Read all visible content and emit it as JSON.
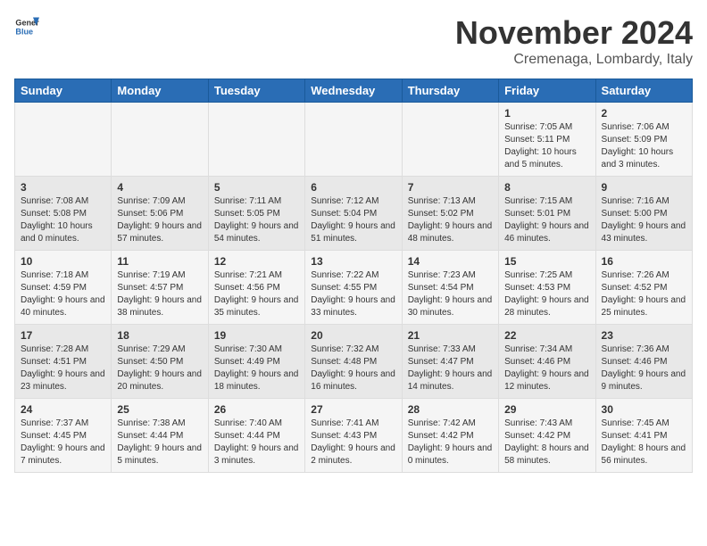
{
  "logo": {
    "general": "General",
    "blue": "Blue"
  },
  "title": "November 2024",
  "subtitle": "Cremenaga, Lombardy, Italy",
  "days_header": [
    "Sunday",
    "Monday",
    "Tuesday",
    "Wednesday",
    "Thursday",
    "Friday",
    "Saturday"
  ],
  "weeks": [
    [
      {
        "day": "",
        "info": ""
      },
      {
        "day": "",
        "info": ""
      },
      {
        "day": "",
        "info": ""
      },
      {
        "day": "",
        "info": ""
      },
      {
        "day": "",
        "info": ""
      },
      {
        "day": "1",
        "info": "Sunrise: 7:05 AM\nSunset: 5:11 PM\nDaylight: 10 hours and 5 minutes."
      },
      {
        "day": "2",
        "info": "Sunrise: 7:06 AM\nSunset: 5:09 PM\nDaylight: 10 hours and 3 minutes."
      }
    ],
    [
      {
        "day": "3",
        "info": "Sunrise: 7:08 AM\nSunset: 5:08 PM\nDaylight: 10 hours and 0 minutes."
      },
      {
        "day": "4",
        "info": "Sunrise: 7:09 AM\nSunset: 5:06 PM\nDaylight: 9 hours and 57 minutes."
      },
      {
        "day": "5",
        "info": "Sunrise: 7:11 AM\nSunset: 5:05 PM\nDaylight: 9 hours and 54 minutes."
      },
      {
        "day": "6",
        "info": "Sunrise: 7:12 AM\nSunset: 5:04 PM\nDaylight: 9 hours and 51 minutes."
      },
      {
        "day": "7",
        "info": "Sunrise: 7:13 AM\nSunset: 5:02 PM\nDaylight: 9 hours and 48 minutes."
      },
      {
        "day": "8",
        "info": "Sunrise: 7:15 AM\nSunset: 5:01 PM\nDaylight: 9 hours and 46 minutes."
      },
      {
        "day": "9",
        "info": "Sunrise: 7:16 AM\nSunset: 5:00 PM\nDaylight: 9 hours and 43 minutes."
      }
    ],
    [
      {
        "day": "10",
        "info": "Sunrise: 7:18 AM\nSunset: 4:59 PM\nDaylight: 9 hours and 40 minutes."
      },
      {
        "day": "11",
        "info": "Sunrise: 7:19 AM\nSunset: 4:57 PM\nDaylight: 9 hours and 38 minutes."
      },
      {
        "day": "12",
        "info": "Sunrise: 7:21 AM\nSunset: 4:56 PM\nDaylight: 9 hours and 35 minutes."
      },
      {
        "day": "13",
        "info": "Sunrise: 7:22 AM\nSunset: 4:55 PM\nDaylight: 9 hours and 33 minutes."
      },
      {
        "day": "14",
        "info": "Sunrise: 7:23 AM\nSunset: 4:54 PM\nDaylight: 9 hours and 30 minutes."
      },
      {
        "day": "15",
        "info": "Sunrise: 7:25 AM\nSunset: 4:53 PM\nDaylight: 9 hours and 28 minutes."
      },
      {
        "day": "16",
        "info": "Sunrise: 7:26 AM\nSunset: 4:52 PM\nDaylight: 9 hours and 25 minutes."
      }
    ],
    [
      {
        "day": "17",
        "info": "Sunrise: 7:28 AM\nSunset: 4:51 PM\nDaylight: 9 hours and 23 minutes."
      },
      {
        "day": "18",
        "info": "Sunrise: 7:29 AM\nSunset: 4:50 PM\nDaylight: 9 hours and 20 minutes."
      },
      {
        "day": "19",
        "info": "Sunrise: 7:30 AM\nSunset: 4:49 PM\nDaylight: 9 hours and 18 minutes."
      },
      {
        "day": "20",
        "info": "Sunrise: 7:32 AM\nSunset: 4:48 PM\nDaylight: 9 hours and 16 minutes."
      },
      {
        "day": "21",
        "info": "Sunrise: 7:33 AM\nSunset: 4:47 PM\nDaylight: 9 hours and 14 minutes."
      },
      {
        "day": "22",
        "info": "Sunrise: 7:34 AM\nSunset: 4:46 PM\nDaylight: 9 hours and 12 minutes."
      },
      {
        "day": "23",
        "info": "Sunrise: 7:36 AM\nSunset: 4:46 PM\nDaylight: 9 hours and 9 minutes."
      }
    ],
    [
      {
        "day": "24",
        "info": "Sunrise: 7:37 AM\nSunset: 4:45 PM\nDaylight: 9 hours and 7 minutes."
      },
      {
        "day": "25",
        "info": "Sunrise: 7:38 AM\nSunset: 4:44 PM\nDaylight: 9 hours and 5 minutes."
      },
      {
        "day": "26",
        "info": "Sunrise: 7:40 AM\nSunset: 4:44 PM\nDaylight: 9 hours and 3 minutes."
      },
      {
        "day": "27",
        "info": "Sunrise: 7:41 AM\nSunset: 4:43 PM\nDaylight: 9 hours and 2 minutes."
      },
      {
        "day": "28",
        "info": "Sunrise: 7:42 AM\nSunset: 4:42 PM\nDaylight: 9 hours and 0 minutes."
      },
      {
        "day": "29",
        "info": "Sunrise: 7:43 AM\nSunset: 4:42 PM\nDaylight: 8 hours and 58 minutes."
      },
      {
        "day": "30",
        "info": "Sunrise: 7:45 AM\nSunset: 4:41 PM\nDaylight: 8 hours and 56 minutes."
      }
    ]
  ]
}
